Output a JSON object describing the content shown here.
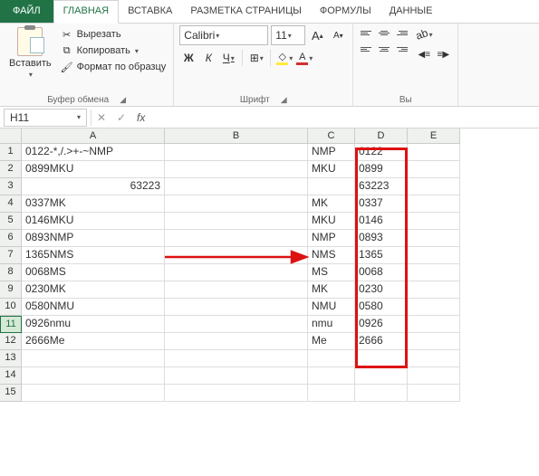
{
  "tabs": {
    "file": "ФАЙЛ",
    "home": "ГЛАВНАЯ",
    "insert": "ВСТАВКА",
    "layout": "РАЗМЕТКА СТРАНИЦЫ",
    "formulas": "ФОРМУЛЫ",
    "data": "ДАННЫЕ"
  },
  "ribbon": {
    "paste": "Вставить",
    "cut": "Вырезать",
    "copy": "Копировать",
    "format_painter": "Формат по образцу",
    "clipboard_group": "Буфер обмена",
    "font_name": "Calibri",
    "font_size": "11",
    "font_group": "Шрифт",
    "bold": "Ж",
    "italic": "К",
    "underline": "Ч",
    "incfont": "A",
    "decfont": "A",
    "alignment_group_partial": "Вы"
  },
  "namebox": "H11",
  "fx_label": "fx",
  "columns": [
    "A",
    "B",
    "C",
    "D",
    "E"
  ],
  "rows": [
    {
      "n": "1",
      "a": "0122-*,/.>+-~NMP",
      "b": "",
      "c": "NMP",
      "d": "0122",
      "e": ""
    },
    {
      "n": "2",
      "a": "0899MKU",
      "b": "",
      "c": "MKU",
      "d": "0899",
      "e": ""
    },
    {
      "n": "3",
      "a": "63223",
      "a_align": "r",
      "b": "",
      "c": "",
      "d": "63223",
      "e": ""
    },
    {
      "n": "4",
      "a": "0337MK",
      "b": "",
      "c": "MK",
      "d": "0337",
      "e": ""
    },
    {
      "n": "5",
      "a": "0146MKU",
      "b": "",
      "c": "MKU",
      "d": "0146",
      "e": ""
    },
    {
      "n": "6",
      "a": "0893NMP",
      "b": "",
      "c": "NMP",
      "d": "0893",
      "e": ""
    },
    {
      "n": "7",
      "a": "1365NMS",
      "b": "",
      "c": "NMS",
      "d": "1365",
      "e": ""
    },
    {
      "n": "8",
      "a": "0068MS",
      "b": "",
      "c": "MS",
      "d": "0068",
      "e": ""
    },
    {
      "n": "9",
      "a": "0230MK",
      "b": "",
      "c": "MK",
      "d": "0230",
      "e": ""
    },
    {
      "n": "10",
      "a": "0580NMU",
      "b": "",
      "c": "NMU",
      "d": "0580",
      "e": ""
    },
    {
      "n": "11",
      "a": "0926nmu",
      "b": "",
      "c": "nmu",
      "d": "0926",
      "e": ""
    },
    {
      "n": "12",
      "a": "2666Me",
      "b": "",
      "c": "Me",
      "d": "2666",
      "e": ""
    },
    {
      "n": "13",
      "a": "",
      "b": "",
      "c": "",
      "d": "",
      "e": ""
    },
    {
      "n": "14",
      "a": "",
      "b": "",
      "c": "",
      "d": "",
      "e": ""
    },
    {
      "n": "15",
      "a": "",
      "b": "",
      "c": "",
      "d": "",
      "e": ""
    }
  ],
  "selected_row": "11"
}
